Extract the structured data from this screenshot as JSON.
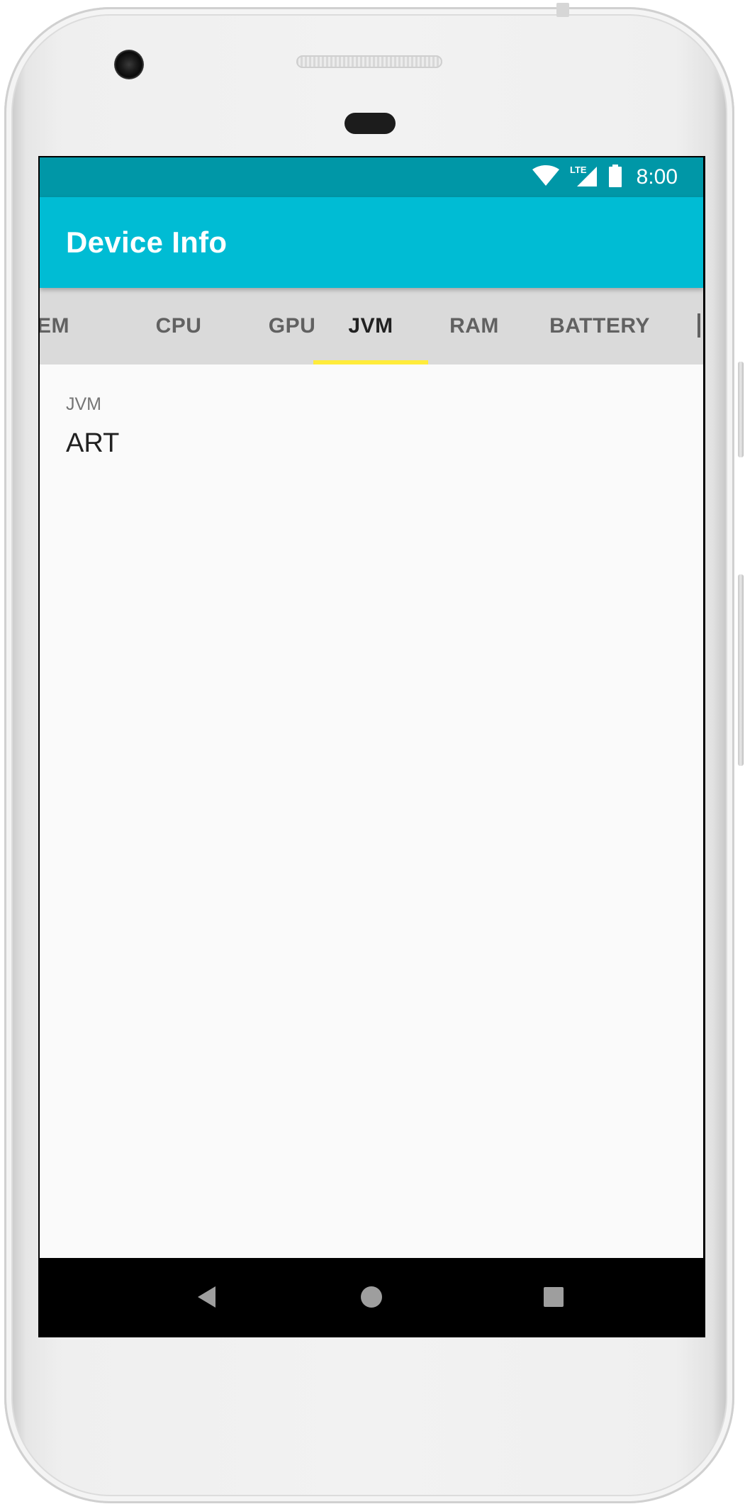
{
  "status_bar": {
    "time": "8:00",
    "network": "LTE",
    "icons": [
      "wifi-icon",
      "lte-signal-icon",
      "battery-icon"
    ],
    "color": "#0097a7"
  },
  "app_bar": {
    "title": "Device Info",
    "color": "#00bcd4"
  },
  "tabs": {
    "items": [
      {
        "label": "EM",
        "active": false
      },
      {
        "label": "CPU",
        "active": false
      },
      {
        "label": "GPU",
        "active": false
      },
      {
        "label": "JVM",
        "active": true
      },
      {
        "label": "RAM",
        "active": false
      },
      {
        "label": "BATTERY",
        "active": false
      }
    ],
    "indicator_color": "#ffeb3b",
    "background": "#dadada"
  },
  "content": {
    "label": "JVM",
    "value": "ART"
  },
  "nav_bar": {
    "buttons": [
      "back-icon",
      "home-icon",
      "recents-icon"
    ]
  }
}
